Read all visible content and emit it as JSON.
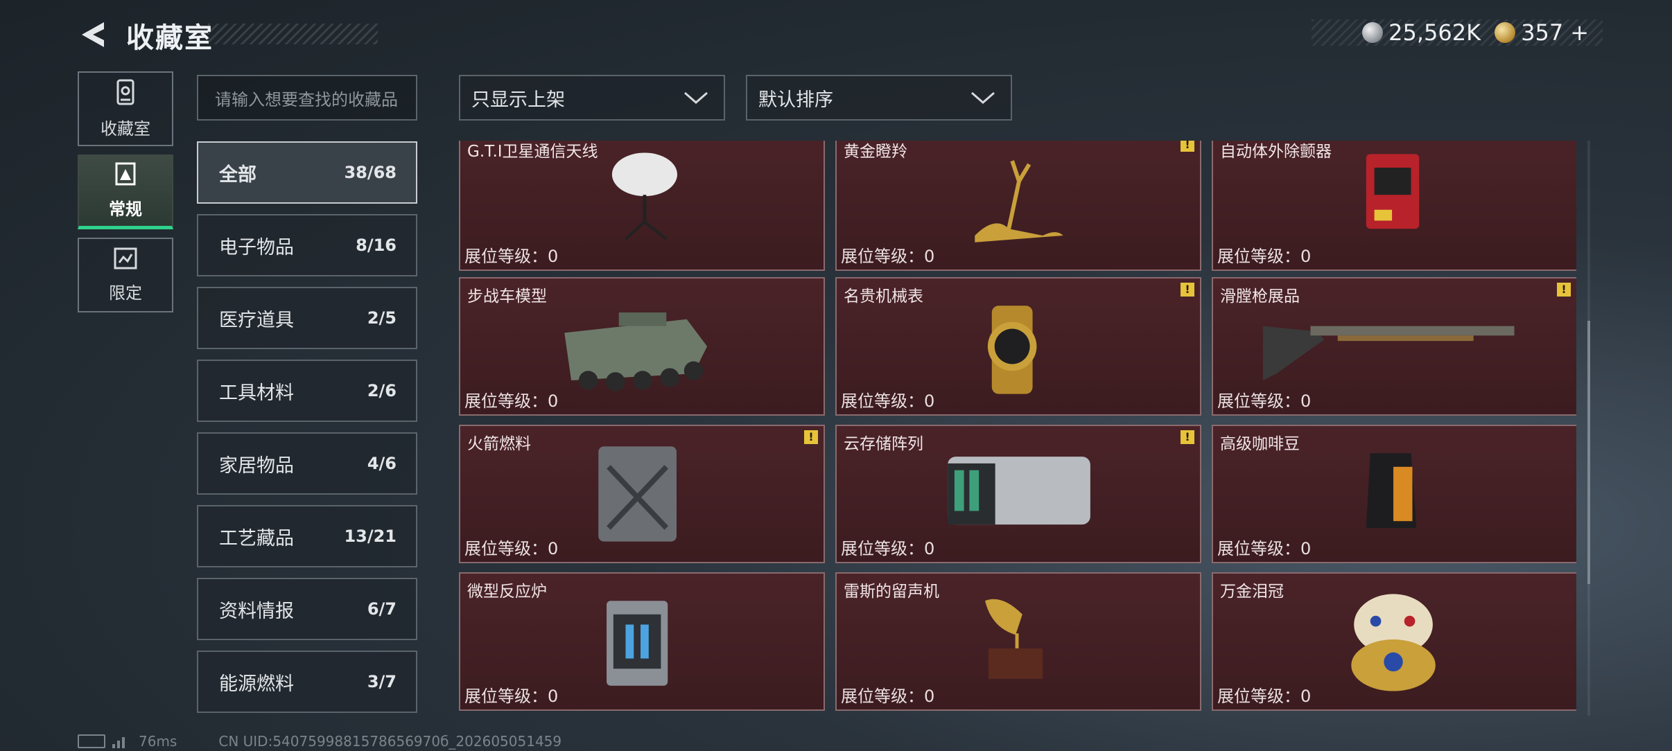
{
  "header": {
    "title": "收藏室",
    "currency": [
      {
        "icon": "silver-coin-icon",
        "value": "25,562K"
      },
      {
        "icon": "gold-coin-icon",
        "value": "357"
      }
    ],
    "add_label": "+"
  },
  "nav": {
    "tabs": [
      {
        "label": "收藏室",
        "icon": "vault-icon"
      },
      {
        "label": "常规",
        "icon": "regular-icon"
      },
      {
        "label": "限定",
        "icon": "limited-icon"
      }
    ],
    "active_index": 1
  },
  "search": {
    "placeholder": "请输入想要查找的收藏品"
  },
  "filters": {
    "display_filter": "只显示上架",
    "sort": "默认排序"
  },
  "categories": [
    {
      "label": "全部",
      "count": "38/68"
    },
    {
      "label": "电子物品",
      "count": "8/16"
    },
    {
      "label": "医疗道具",
      "count": "2/5"
    },
    {
      "label": "工具材料",
      "count": "2/6"
    },
    {
      "label": "家居物品",
      "count": "4/6"
    },
    {
      "label": "工艺藏品",
      "count": "13/21"
    },
    {
      "label": "资料情报",
      "count": "6/7"
    },
    {
      "label": "能源燃料",
      "count": "3/7"
    }
  ],
  "items": [
    {
      "name": "G.T.I卫星通信天线",
      "level": "展位等级：0",
      "warn": false
    },
    {
      "name": "黄金瞪羚",
      "level": "展位等级：0",
      "warn": true
    },
    {
      "name": "自动体外除颤器",
      "level": "展位等级：0",
      "warn": false
    },
    {
      "name": "步战车模型",
      "level": "展位等级：0",
      "warn": false
    },
    {
      "name": "名贵机械表",
      "level": "展位等级：0",
      "warn": true
    },
    {
      "name": "滑膛枪展品",
      "level": "展位等级：0",
      "warn": true
    },
    {
      "name": "火箭燃料",
      "level": "展位等级：0",
      "warn": true
    },
    {
      "name": "云存储阵列",
      "level": "展位等级：0",
      "warn": true
    },
    {
      "name": "高级咖啡豆",
      "level": "展位等级：0",
      "warn": false
    },
    {
      "name": "微型反应炉",
      "level": "展位等级：0",
      "warn": false
    },
    {
      "name": "雷斯的留声机",
      "level": "展位等级：0",
      "warn": false
    },
    {
      "name": "万金泪冠",
      "level": "展位等级：0",
      "warn": false
    }
  ],
  "warn_symbol": "!",
  "status": {
    "ping": "76ms",
    "uid": "CN UID:5407599881578656970б_202605051459"
  }
}
